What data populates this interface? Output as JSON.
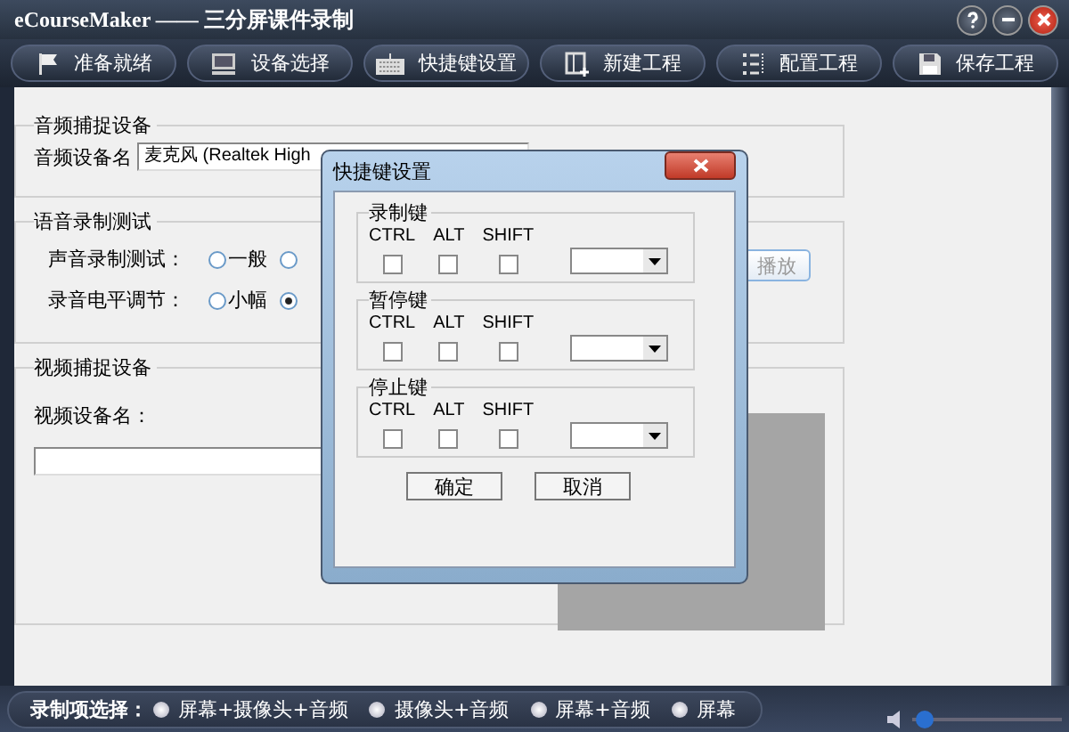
{
  "window": {
    "title": "eCourseMaker —— 三分屏课件录制"
  },
  "toolbar": [
    {
      "label": "准备就绪"
    },
    {
      "label": "设备选择"
    },
    {
      "label": "快捷键设置"
    },
    {
      "label": "新建工程"
    },
    {
      "label": "配置工程"
    },
    {
      "label": "保存工程"
    }
  ],
  "audio_capture": {
    "title": "音频捕捉设备",
    "device_label": "音频设备名",
    "device_value": "麦克风 (Realtek High"
  },
  "voice_test": {
    "title": "语音录制测试",
    "rows": [
      {
        "label": "声音录制测试：",
        "options": [
          {
            "label": "一般",
            "selected": false
          },
          {
            "selected": false
          }
        ]
      },
      {
        "label": "录音电平调节：",
        "options": [
          {
            "label": "小幅",
            "selected": false
          },
          {
            "selected": true
          }
        ]
      }
    ],
    "play_button": {
      "label": "播放",
      "disabled": true
    }
  },
  "video_capture": {
    "title": "视频捕捉设备",
    "device_label": "视频设备名："
  },
  "dialog": {
    "title": "快捷键设置",
    "groups": [
      {
        "title": "录制键",
        "modifiers": [
          {
            "label": "CTRL",
            "checked": false
          },
          {
            "label": "ALT",
            "checked": false
          },
          {
            "label": "SHIFT",
            "checked": false
          }
        ]
      },
      {
        "title": "暂停键",
        "modifiers": [
          {
            "label": "CTRL",
            "checked": false
          },
          {
            "label": "ALT",
            "checked": false
          },
          {
            "label": "SHIFT",
            "checked": false
          }
        ]
      },
      {
        "title": "停止键",
        "modifiers": [
          {
            "label": "CTRL",
            "checked": false
          },
          {
            "label": "ALT",
            "checked": false
          },
          {
            "label": "SHIFT",
            "checked": false
          }
        ]
      }
    ],
    "buttons": [
      "确定",
      "取消"
    ]
  },
  "record_options": {
    "label": "录制项选择：",
    "options": [
      {
        "label": "屏幕+摄像头+音频",
        "selected": false
      },
      {
        "label": "摄像头+音频",
        "selected": false
      },
      {
        "label": "屏幕+音频",
        "selected": false
      },
      {
        "label": "屏幕",
        "selected": false
      }
    ]
  },
  "volume": {
    "level": 0.05
  }
}
